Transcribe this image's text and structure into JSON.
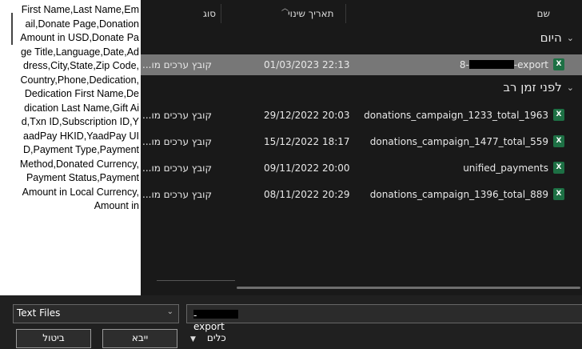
{
  "preview_text": "First Name,Last Name,Email,Donate Page,Donation Amount in USD,Donate Page Title,Language,Date,Address,City,State,Zip Code,Country,Phone,Dedication,Dedication First Name,Dedication Last Name,Gift Aid,Txn ID,Subscription ID,YaadPay HKID,YaadPay UID,Payment Type,Payment Method,Donated Currency,Payment Status,Payment Amount in Local Currency,Amount in",
  "columns": {
    "name": "שם",
    "modified": "תאריך שינוי",
    "type": "סוג"
  },
  "groups": [
    {
      "label": "היום",
      "files": [
        {
          "name_prefix": "8-",
          "name_suffix": "-export",
          "date": "01/03/2023 22:13",
          "type": "קובץ ערכים מו...",
          "icon": "excel-csv-icon",
          "selected": true
        }
      ]
    },
    {
      "label": "לפני זמן רב",
      "files": [
        {
          "name_prefix": "donations_campaign_1233_total_1963",
          "name_suffix": "",
          "date": "29/12/2022 20:03",
          "type": "קובץ ערכים מו...",
          "icon": "excel-csv-icon",
          "selected": false
        },
        {
          "name_prefix": "donations_campaign_1477_total_559",
          "name_suffix": "",
          "date": "15/12/2022 18:17",
          "type": "קובץ ערכים מו...",
          "icon": "excel-csv-icon",
          "selected": false
        },
        {
          "name_prefix": "unified_payments",
          "name_suffix": "",
          "date": "09/11/2022 20:00",
          "type": "קובץ ערכים מו...",
          "icon": "excel-csv-icon",
          "selected": false
        },
        {
          "name_prefix": "donations_campaign_1396_total_889",
          "name_suffix": "",
          "date": "08/11/2022 20:29",
          "type": "קובץ ערכים מו...",
          "icon": "excel-csv-icon",
          "selected": false
        }
      ]
    }
  ],
  "file_type_filter": "Text Files",
  "filename_field": {
    "prefix": "8-",
    "suffix": "-export"
  },
  "buttons": {
    "tools": "כלים",
    "open": "ייבא",
    "cancel": "ביטול"
  },
  "colors": {
    "selected_row": "#777777",
    "background": "#191919",
    "excel_green": "#1d7044"
  }
}
